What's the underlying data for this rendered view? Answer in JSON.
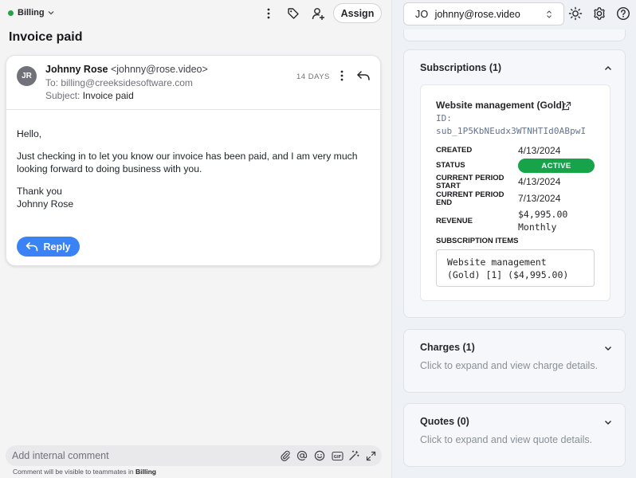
{
  "left": {
    "mailbox": {
      "label": "Billing"
    },
    "toolbar": {
      "assign_label": "Assign"
    },
    "conversation": {
      "title": "Invoice paid"
    },
    "message": {
      "avatar_initials": "JR",
      "sender_name": "Johnny Rose",
      "sender_email": "<johnny@rose.video>",
      "to_prefix": "To: ",
      "to": "billing@creeksidesoftware.com",
      "subject_prefix": "Subject: ",
      "subject": "Invoice paid",
      "time": "14 DAYS",
      "body": [
        "Hello,",
        "Just checking in to let you know our invoice has been paid, and I am very much looking forward to doing business with you.",
        "Thank you",
        "Johnny Rose"
      ],
      "reply_label": "Reply"
    },
    "comment": {
      "placeholder": "Add internal comment",
      "hint_prefix": "Comment will be visible to teammates in ",
      "hint_mailbox": "Billing"
    }
  },
  "right": {
    "contact": {
      "initials": "JO",
      "email": "johnny@rose.video"
    },
    "subscriptions": {
      "title": "Subscriptions (1)",
      "item": {
        "name": "Website management (Gold)",
        "id_label": "ID:",
        "id": "sub_1P5KbNEudx3WTNHTId0ABpwI",
        "created_label": "CREATED",
        "created": "4/13/2024",
        "status_label": "STATUS",
        "status": "ACTIVE",
        "period_start_label": "CURRENT PERIOD START",
        "period_start": "4/13/2024",
        "period_end_label": "CURRENT PERIOD END",
        "period_end": "7/13/2024",
        "revenue_label": "REVENUE",
        "revenue_amount": "$4,995.00",
        "revenue_interval": "Monthly",
        "items_label": "SUBSCRIPTION ITEMS",
        "items": "Website management (Gold) [1] ($4,995.00)"
      }
    },
    "charges": {
      "title": "Charges (1)",
      "hint": "Click to expand and view charge details."
    },
    "quotes": {
      "title": "Quotes (0)",
      "hint": "Click to expand and view quote details."
    }
  },
  "colors": {
    "accent": "#3b82f6",
    "status_active": "#16a34a",
    "mailbox_dot": "#22a447"
  },
  "icons": [
    "chevron-down-icon",
    "more-vertical-icon",
    "tag-icon",
    "add-user-icon",
    "reply-icon",
    "paperclip-icon",
    "at-icon",
    "emoji-icon",
    "gif-icon",
    "magic-wand-icon",
    "expand-icon",
    "updown-icon",
    "sun-icon",
    "gear-icon",
    "help-icon",
    "external-link-icon",
    "chevron-up-icon"
  ]
}
